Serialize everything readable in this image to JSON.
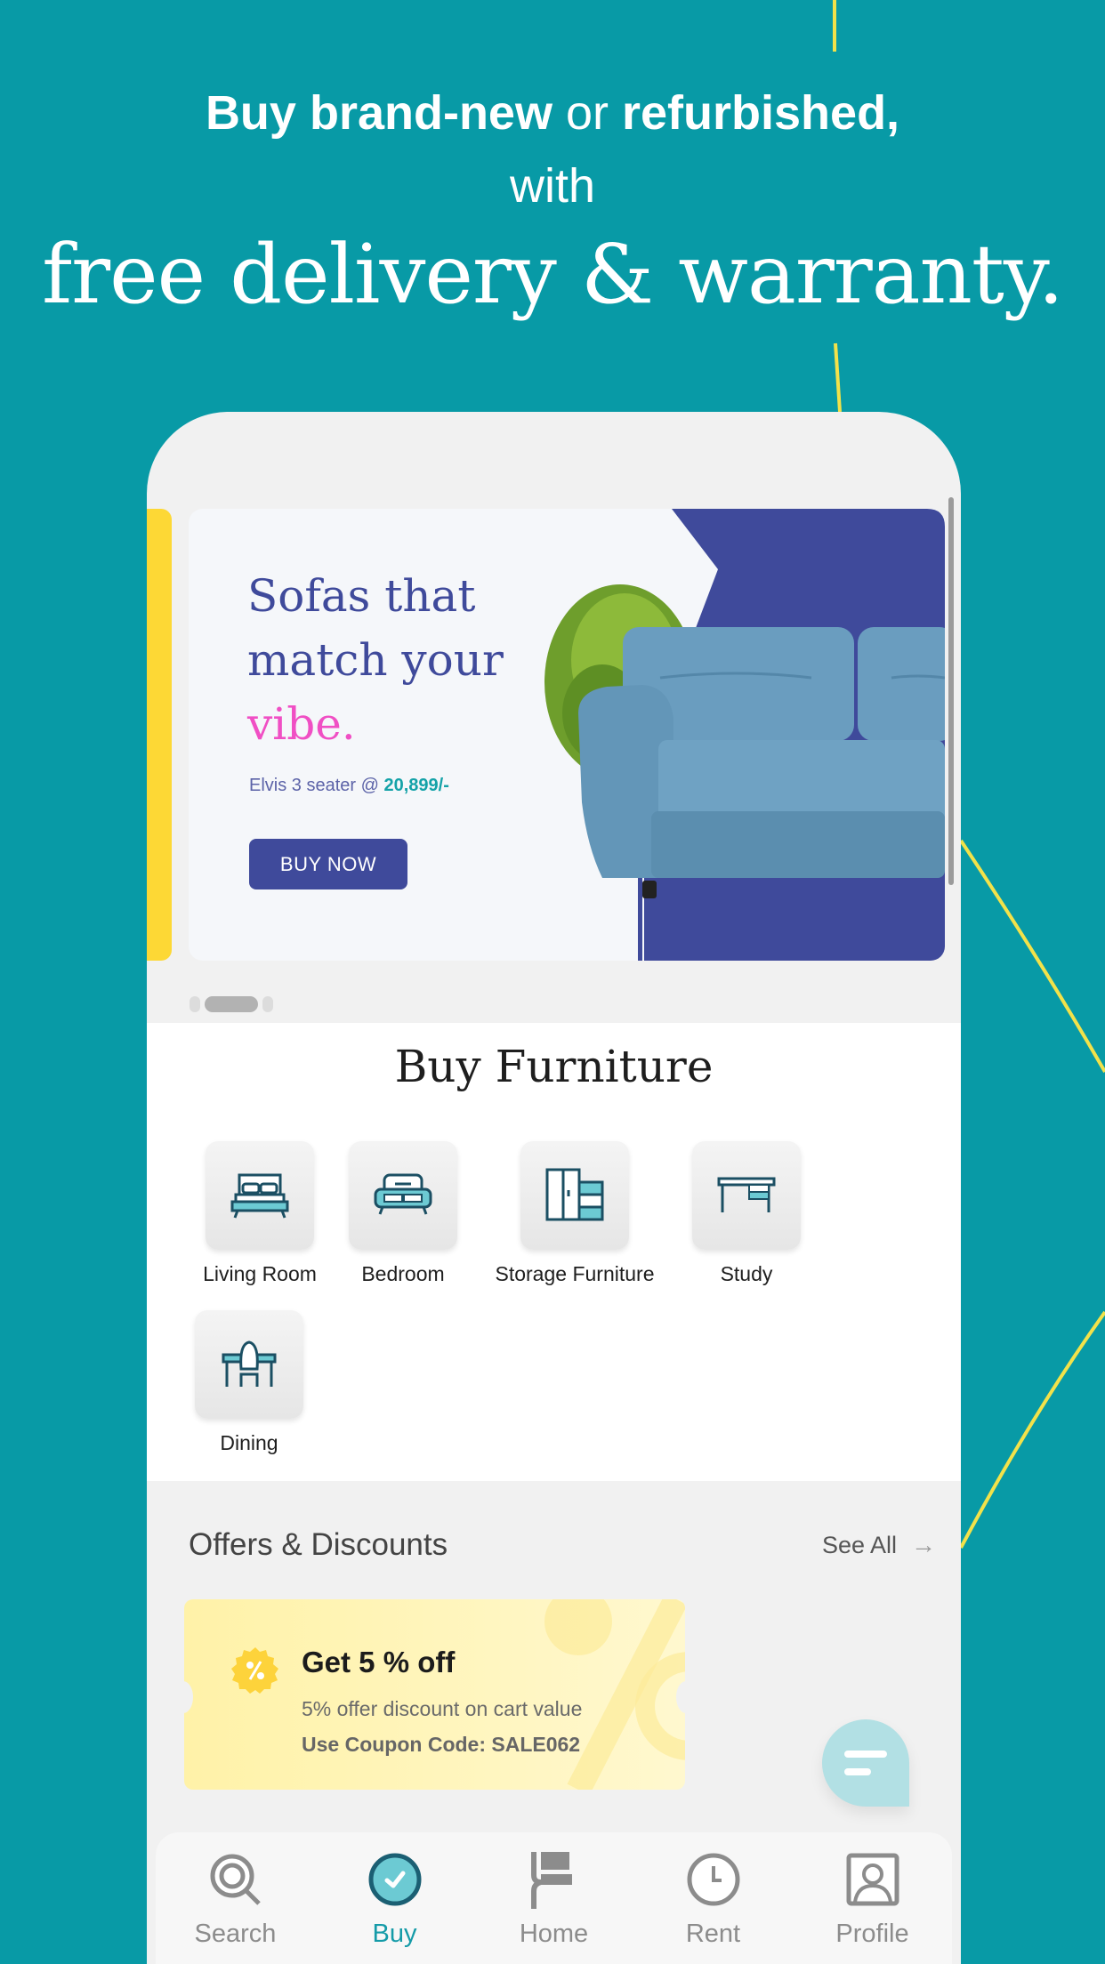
{
  "headline": {
    "line1_bold_a": "Buy brand-new",
    "line1_thin": " or ",
    "line1_bold_b": "refurbished,",
    "line2": "with",
    "line3": "free delivery & warranty."
  },
  "banner": {
    "title_line1": "Sofas that",
    "title_line2": "match your",
    "title_line3": "vibe.",
    "subtitle_prefix": "Elvis 3 seater @ ",
    "price": "20,899/-",
    "button_label": "BUY NOW",
    "carousel": {
      "total": 3,
      "active_index": 1
    }
  },
  "buy_section": {
    "title": "Buy Furniture",
    "categories": [
      {
        "label": "Living Room",
        "icon": "bed-icon"
      },
      {
        "label": "Bedroom",
        "icon": "sofa-icon"
      },
      {
        "label": "Storage Furniture",
        "icon": "wardrobe-icon"
      },
      {
        "label": "Study",
        "icon": "desk-icon"
      },
      {
        "label": "Dining",
        "icon": "dining-table-icon"
      }
    ]
  },
  "offers": {
    "title": "Offers & Discounts",
    "see_all_label": "See All",
    "coupon": {
      "title": "Get 5 % off",
      "description": "5% offer discount on cart value",
      "code_line": "Use Coupon Code: SALE062"
    }
  },
  "chat": {
    "icon": "chat-icon"
  },
  "bottom_nav": {
    "active": "Buy",
    "items": [
      {
        "label": "Search",
        "icon": "search-icon"
      },
      {
        "label": "Buy",
        "icon": "check-circle-icon"
      },
      {
        "label": "Home",
        "icon": "home-flag-icon"
      },
      {
        "label": "Rent",
        "icon": "clock-icon"
      },
      {
        "label": "Profile",
        "icon": "profile-icon"
      }
    ]
  },
  "colors": {
    "background": "#089AA6",
    "accent_yellow": "#FDD835",
    "brand_indigo": "#3F4A9B",
    "brand_pink": "#F04FC4",
    "brand_teal": "#159BA8"
  }
}
